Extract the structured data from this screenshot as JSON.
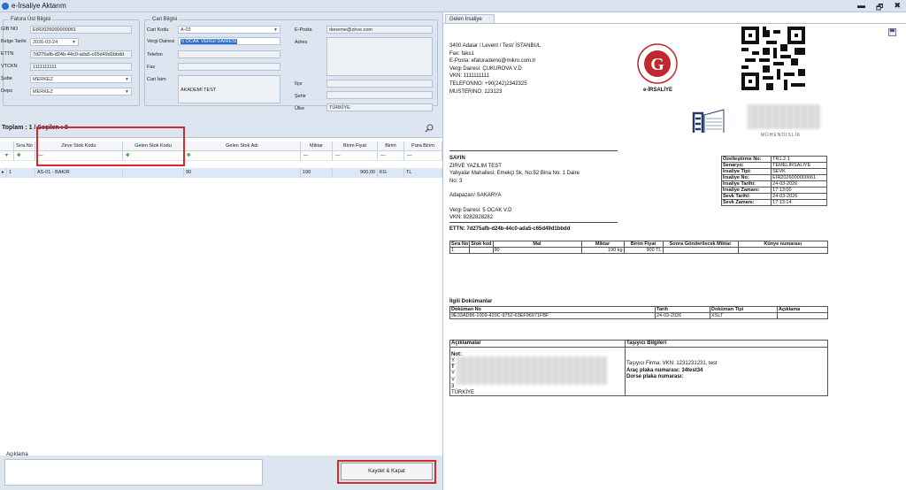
{
  "window": {
    "title": "e-İrsaliye Aktarım",
    "minimize": "▬",
    "restore": "🗗",
    "close": "✖"
  },
  "fatura_group": {
    "title": "Fatura Üst Bilgisi",
    "gib_no_label": "GİB NO",
    "gib_no": "EIR2026000000061",
    "belge_tarihi_label": "Belge Tarihi",
    "belge_tarihi": "2026-03-24",
    "ettn_label": "ETTN",
    "ettn": "7d275afb-d24b-44c0-ada5-c65d49d1bbdd",
    "vtckn_label": "VTCKN",
    "vtckn": "1111111111",
    "sube_label": "Şube",
    "sube": "MERKEZ",
    "depo_label": "Depo",
    "depo": "MERKEZ"
  },
  "cari_group": {
    "title": "Cari Bilgisi",
    "cari_kodu_label": "Cari Kodu",
    "cari_kodu": "A-03",
    "vergi_dairesi_label": "Vergi Dairesi",
    "vergi_dairesi": "5 OCAK VERGİ DAİRESİ",
    "telefon_label": "Telefon",
    "fax_label": "Fax",
    "cari_isim_label": "Cari İsim",
    "cari_isim": "AKADEMİ TEST",
    "eposta_label": "E-Posta",
    "eposta": "deneme@zirve.com",
    "adres_label": "Adres",
    "ilce_label": "İlçe",
    "sehir_label": "Şehir",
    "ulke_label": "Ülke",
    "ulke": "TÜRKİYE"
  },
  "summary": "Toplam : 1 / Seçilen : 0",
  "grid": {
    "headers": [
      "Sıra No",
      "Zirve Stok Kodu",
      "Gelen Stok Kodu",
      "Gelen Stok Adı",
      "Miktar",
      "Birim Fiyat",
      "Birim",
      "Para Birim"
    ],
    "filter_marks": [
      "=",
      "—",
      "",
      "",
      "—",
      "—",
      "—",
      "—"
    ],
    "filter_plus": "✚",
    "filter_lead": "▼",
    "row_mark": "▸",
    "row": {
      "sira": "1",
      "zirve_stok": "AS-01 - BAKIR",
      "gelen_stok": "",
      "gelen_stok_adi": "90",
      "miktar": "190",
      "birim_fiyat": "900,00",
      "birim": "KG",
      "para_birim": "TL"
    }
  },
  "aciklama_label": "Açıklama",
  "save_button": "Kaydet & Kapat",
  "right": {
    "tab": "Gelen İrsaliye",
    "sender": [
      "3400 Adalar / Levent / Test/ İSTANBUL",
      "Fax: faks1",
      "E-Posta: efaturademo@mikro.com.tr",
      "Vergi Dairesi: ÇUKUROVA V.D",
      "VKN: 1111111111",
      "TELEFONNO: +90(242)2342325",
      "MUSTERINO: 123123"
    ],
    "logo_caption": "e-İRSALİYE",
    "company_caption": "MÜHENDİSLİK",
    "sayin": "SAYIN",
    "receiver": [
      "ZIRVE YAZILIM TEST",
      "Yahyalar Mahallesi, Emekçi Sk, No:52 Bina No: 1 Daire",
      "No: 3",
      "",
      "Adapazarı/ SAKARYA",
      "",
      "Vergi Dairesi: 5 OCAK V.D",
      "VKN: 8282828282"
    ],
    "info": [
      [
        "Özelleştirme No:",
        "TR1.2.1"
      ],
      [
        "Senaryo:",
        "TEMELIRSALIYE"
      ],
      [
        "İrsaliye Tipi:",
        "SEVK"
      ],
      [
        "İrsaliye No:",
        "EIR2026000000061"
      ],
      [
        "İrsaliye Tarihi:",
        "24-03-2026"
      ],
      [
        "İrsaliye Zamanı:",
        "17:13:00"
      ],
      [
        "Sevk Tarihi:",
        "24-03-2026"
      ],
      [
        "Sevk Zamanı:",
        "17:13:14"
      ]
    ],
    "ettn": "ETTN: 7d275afb-d24b-44c0-ada5-c65d49d1bbdd",
    "lines_headers": [
      "Sıra No",
      "Stok kod",
      "Mal",
      "Miktar",
      "Birim Fiyat",
      "Sonra Gönderilecek Miktar",
      "Künye numarası"
    ],
    "lines_row": [
      "1",
      "",
      "90",
      "190 kg",
      "900 TL",
      "",
      ""
    ],
    "docs_title": "İlgili Dokümanlar",
    "docs_headers": [
      "Doküman No",
      "Tarih",
      "Doküman Tipi",
      "Açıklama"
    ],
    "docs_row": [
      "9E33AD86-1009-420C-9752-63EF96971FBF",
      "24-03-2026",
      "XSLT",
      ""
    ],
    "notes_title": "Açıklamalar",
    "carrier_title": "Taşıyıcı Bilgileri",
    "not_label": "Not:",
    "note_lines": [
      "Y",
      "T",
      "Y",
      "Y",
      "3",
      "TÜRKİYE"
    ],
    "carrier_lines": [
      "Taşıyıcı Firma: VKN: 1231231231, test",
      "Araç plaka numarası: 34test34",
      "Dorse plaka numarası:"
    ]
  }
}
